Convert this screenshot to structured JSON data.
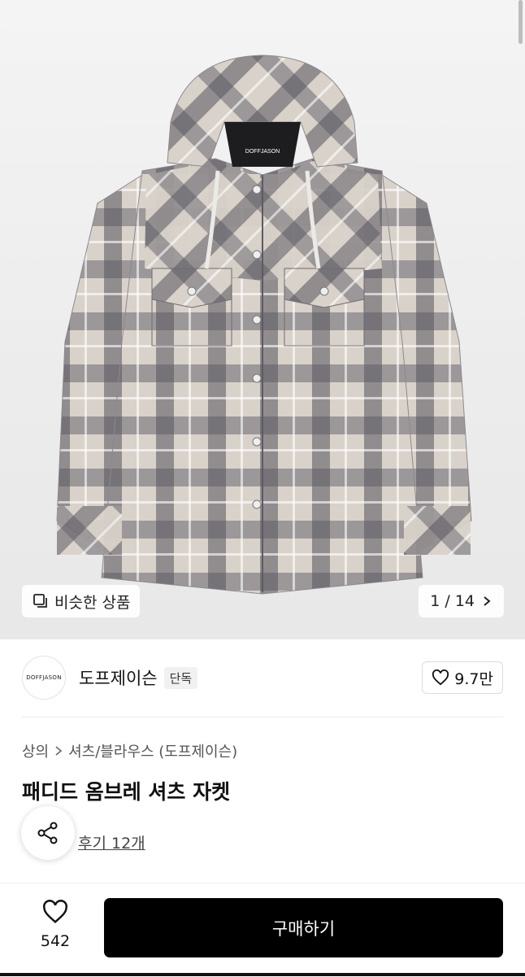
{
  "product_image": {
    "brand_label": "DOFFJASON"
  },
  "image_chips": {
    "similar_label": "비슷한 상품",
    "counter": "1 / 14"
  },
  "brand": {
    "logo_text": "DOFFJASON",
    "name": "도프제이슨",
    "badge": "단독",
    "likes": "9.7만"
  },
  "breadcrumb": {
    "category": "상의",
    "subcategory": "셔츠/블라우스 (도프제이슨)"
  },
  "product": {
    "title": "패디드 옴브레 셔츠 자켓",
    "review_label": "후기 12개"
  },
  "bottom_bar": {
    "wish_count": "542",
    "buy_label": "구매하기"
  }
}
